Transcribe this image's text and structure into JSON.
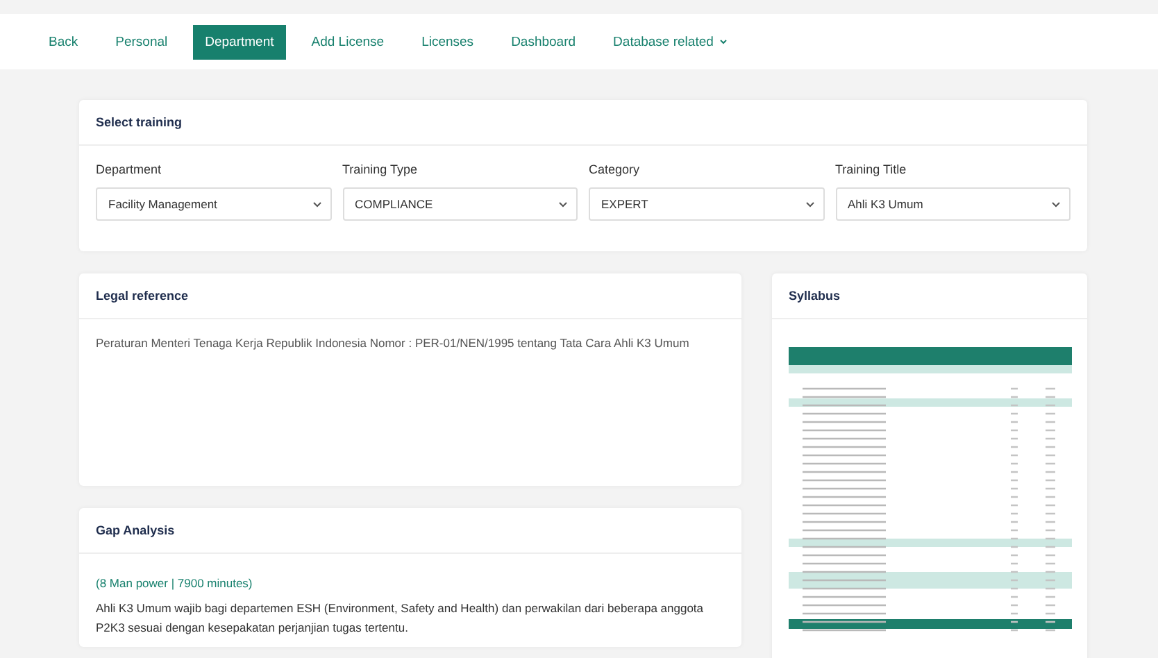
{
  "nav": [
    {
      "label": "Back",
      "selected": false,
      "has_menu": false
    },
    {
      "label": "Personal",
      "selected": false,
      "has_menu": false
    },
    {
      "label": "Department",
      "selected": true,
      "has_menu": false
    },
    {
      "label": "Add License",
      "selected": false,
      "has_menu": false
    },
    {
      "label": "Licenses",
      "selected": false,
      "has_menu": false
    },
    {
      "label": "Dashboard",
      "selected": false,
      "has_menu": false
    },
    {
      "label": "Database related",
      "selected": false,
      "has_menu": true
    }
  ],
  "select_training": {
    "title": "Select training",
    "fields": [
      {
        "label": "Department",
        "value": "Facility Management"
      },
      {
        "label": "Training Type",
        "value": "COMPLIANCE"
      },
      {
        "label": "Category",
        "value": "EXPERT"
      },
      {
        "label": "Training Title",
        "value": "Ahli K3 Umum"
      }
    ]
  },
  "legal_reference": {
    "title": "Legal reference",
    "text": "Peraturan Menteri Tenaga Kerja Republik Indonesia Nomor : PER-01/NEN/1995 tentang Tata Cara Ahli K3 Umum"
  },
  "gap_analysis": {
    "title": "Gap Analysis",
    "summary": "(8 Man power | 7900 minutes)",
    "text": "Ahli K3 Umum wajib bagi departemen ESH (Environment, Safety and Health) dan perwakilan dari beberapa anggota P2K3 sesuai dengan kesepakatan perjanjian tugas tertentu."
  },
  "syllabus": {
    "title": "Syllabus"
  }
}
